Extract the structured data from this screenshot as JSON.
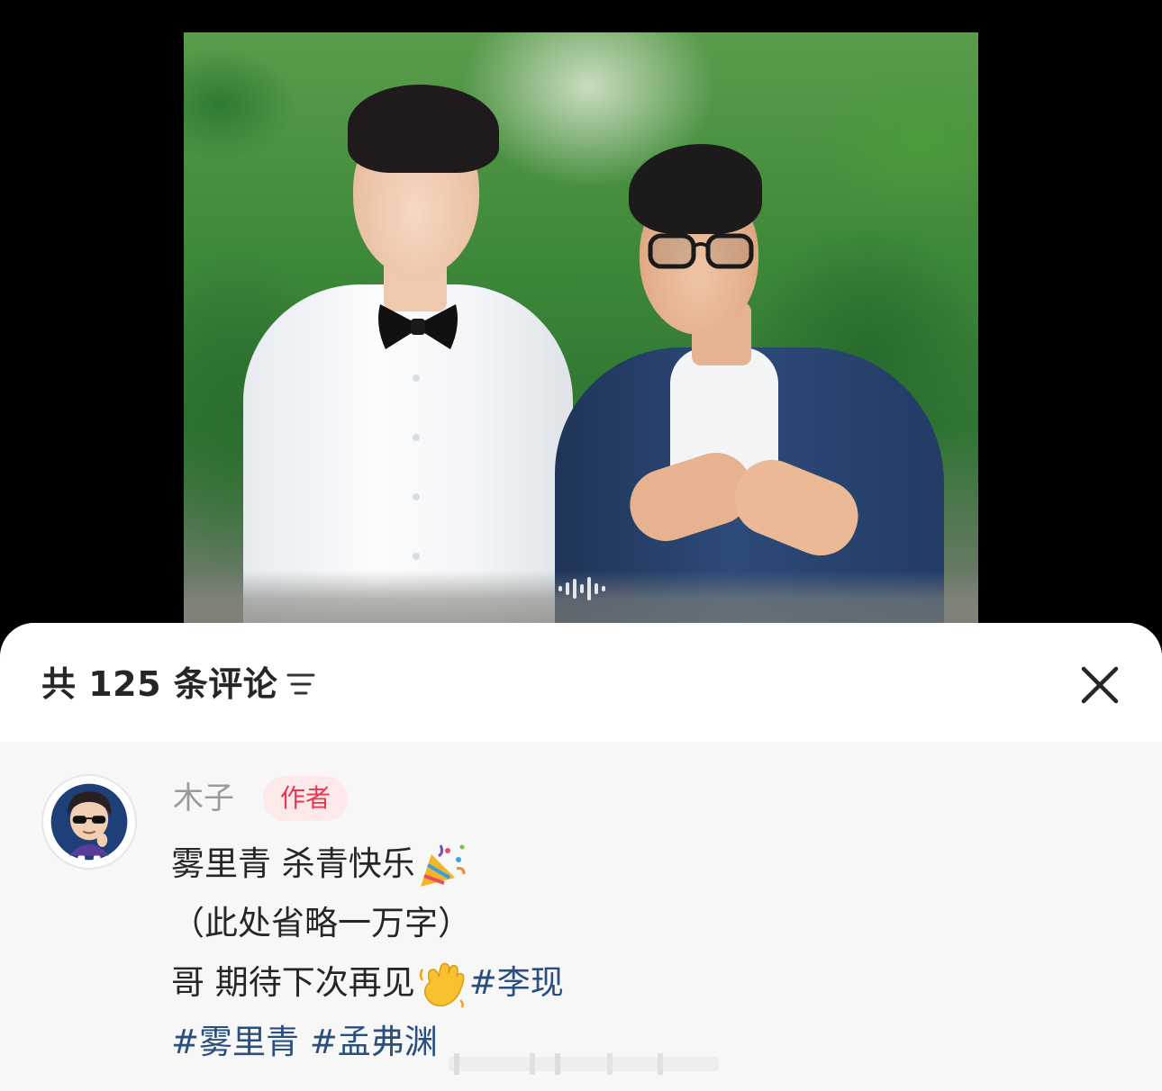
{
  "photo": {
    "description_icon": "audio-wave-icon"
  },
  "comments_sheet": {
    "title": "共 125 条评论",
    "sort_icon": "sort-lines-icon",
    "close_icon": "close-icon"
  },
  "comment": {
    "author": "木子",
    "author_badge": "作者",
    "line1_text": "雾里青 杀青快乐",
    "line1_emoji": "party-popper-icon",
    "line2_text": "（此处省略一万字）",
    "line3_text": "哥 期待下次再见",
    "line3_emoji": "waving-hand-icon",
    "hashtags": [
      "#李现",
      "#雾里青",
      "#孟弗渊"
    ]
  },
  "colors": {
    "badge_text": "#e8364f",
    "badge_bg": "#fde8ea",
    "hashtag": "#2a4f7e",
    "author": "#9a9a9a"
  }
}
